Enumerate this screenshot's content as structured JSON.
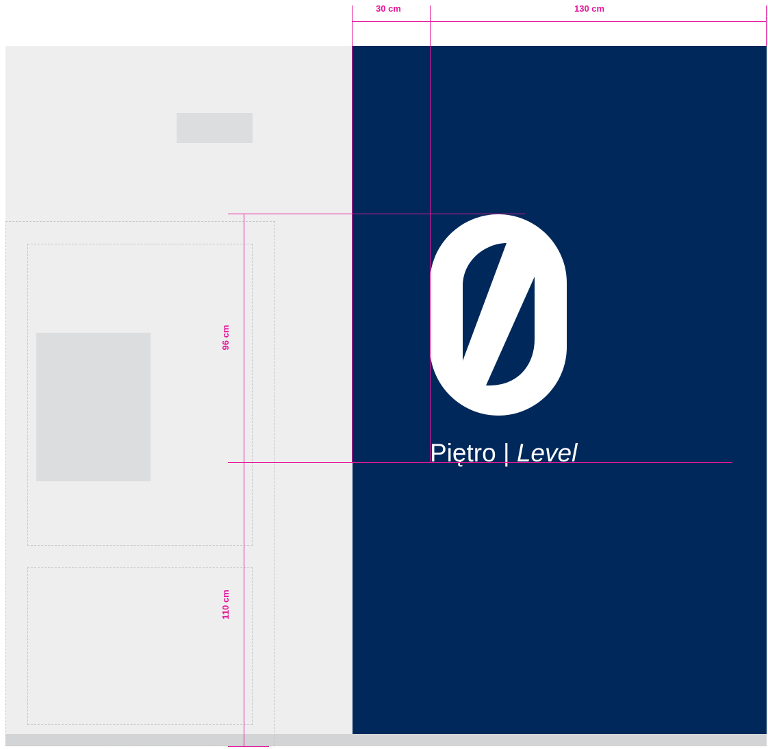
{
  "sign": {
    "numeral": "0",
    "label_pl": "Piętro",
    "separator": "|",
    "label_en": "Level"
  },
  "dimensions": {
    "top_left": "30 cm",
    "top_right": "130 cm",
    "upper_vertical": "96 cm",
    "lower_vertical": "110 cm"
  },
  "colors": {
    "panel": "#00285a",
    "wall": "#eeeeee",
    "dimension": "#e5169b",
    "numeral": "#ffffff"
  }
}
